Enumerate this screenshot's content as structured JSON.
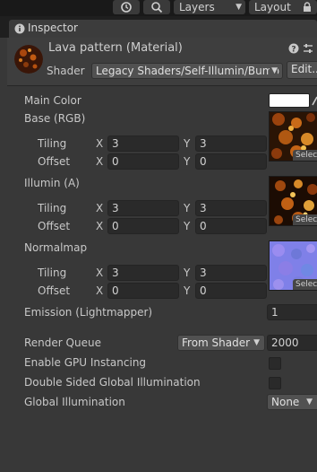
{
  "toolbar": {
    "layers_label": "Layers",
    "layout_label": "Layout",
    "history_icon": "history-icon",
    "search_icon": "search-icon",
    "lock_icon": "lock-icon"
  },
  "tab": {
    "title": "Inspector",
    "icon": "info-icon"
  },
  "header": {
    "title": "Lava pattern (Material)",
    "shader_label": "Shader",
    "shader_value": "Legacy Shaders/Self-Illumin/Bump",
    "edit_label": "Edit...",
    "help_icon": "help-icon",
    "settings_icon": "sliders-icon"
  },
  "properties": {
    "main_color_label": "Main Color",
    "main_color_value": "#ffffff",
    "base": {
      "label": "Base (RGB)",
      "tiling_label": "Tiling",
      "offset_label": "Offset",
      "tiling_x": "3",
      "tiling_y": "3",
      "offset_x": "0",
      "offset_y": "0",
      "select_label": "Select"
    },
    "illumin": {
      "label": "Illumin (A)",
      "tiling_label": "Tiling",
      "offset_label": "Offset",
      "tiling_x": "3",
      "tiling_y": "3",
      "offset_x": "0",
      "offset_y": "0",
      "select_label": "Select"
    },
    "normal": {
      "label": "Normalmap",
      "tiling_label": "Tiling",
      "offset_label": "Offset",
      "tiling_x": "3",
      "tiling_y": "3",
      "offset_x": "0",
      "offset_y": "0",
      "select_label": "Select"
    },
    "x_label": "X",
    "y_label": "Y",
    "emission_label": "Emission (Lightmapper)",
    "emission_value": "1"
  },
  "advanced": {
    "render_queue_label": "Render Queue",
    "render_queue_mode": "From Shader",
    "render_queue_value": "2000",
    "gpu_instancing_label": "Enable GPU Instancing",
    "double_sided_gi_label": "Double Sided Global Illumination",
    "global_illumination_label": "Global Illumination",
    "global_illumination_value": "None"
  },
  "colors": {
    "background": "#383838",
    "field": "#2a2a2a",
    "text": "#c8c8c8"
  }
}
